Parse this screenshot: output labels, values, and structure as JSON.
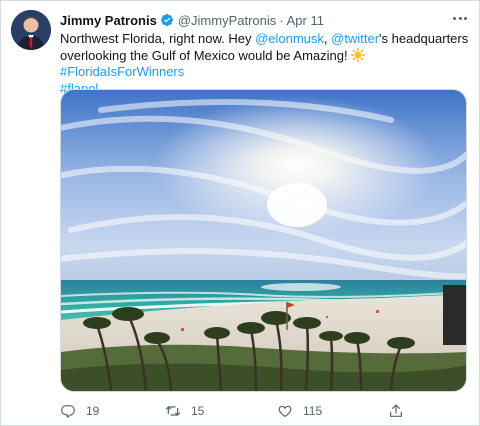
{
  "tweet": {
    "author_name": "Jimmy Patronis",
    "handle": "@JimmyPatronis",
    "separator": "·",
    "date": "Apr 11",
    "text_part1": "Northwest Florida, right now. Hey ",
    "mention1": "@elonmusk",
    "text_part2": ", ",
    "mention2": "@twitter",
    "text_part3": "'s headquarters overlooking the Gulf of Mexico would be Amazing! ",
    "emoji_icon": "sun-emoji",
    "text_part4": " ",
    "hashtag1": "#FloridaIsForWinners",
    "hashtag2": "#flapol",
    "verified_icon": "verified-badge-icon",
    "colors": {
      "link": "#1d9bf0",
      "secondary_text": "#536471",
      "border": "#cfd9de"
    }
  },
  "actions": {
    "reply_count": "19",
    "retweet_count": "15",
    "like_count": "115"
  }
}
